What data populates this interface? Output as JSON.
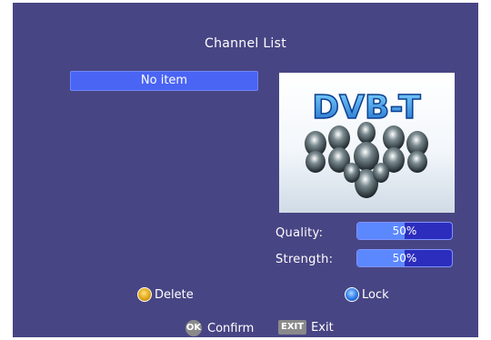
{
  "screen": {
    "title": "Channel List"
  },
  "channel_list": {
    "items": [
      {
        "label": "No item"
      }
    ]
  },
  "preview": {
    "logo_text": "DVB-T"
  },
  "signal": {
    "quality_label": "Quality:",
    "quality_value": "50%",
    "quality_fraction": 0.5,
    "strength_label": "Strength:",
    "strength_value": "50%",
    "strength_fraction": 0.5
  },
  "legend": {
    "delete_label": "Delete",
    "lock_label": "Lock",
    "ok_key": "OK",
    "confirm_label": "Confirm",
    "exit_key": "EXIT",
    "exit_label": "Exit"
  },
  "colors": {
    "background": "#484584",
    "highlight": "#4a64f4",
    "bar_track": "#2c2dbd",
    "bar_fill": "#5c88ff",
    "delete_key": "#e0a515",
    "lock_key": "#2a78e6"
  }
}
